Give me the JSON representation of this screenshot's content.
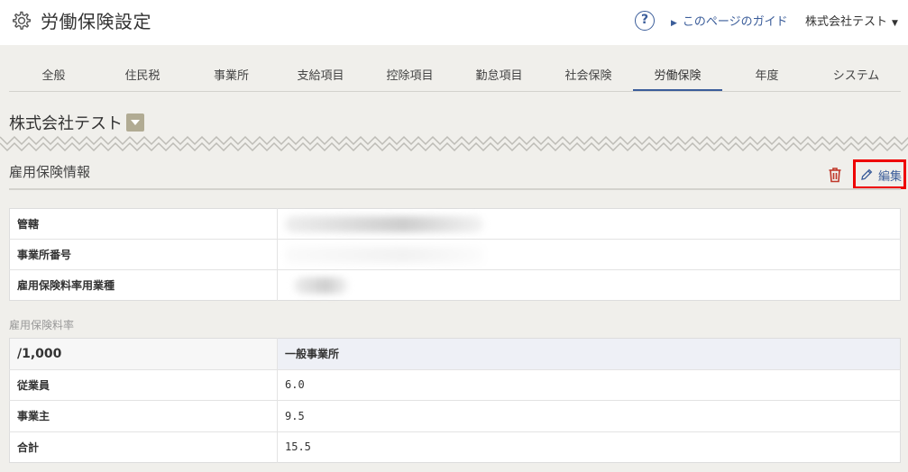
{
  "header": {
    "title": "労働保険設定",
    "help_label": "?",
    "guide_label": "このページのガイド",
    "company_menu_label": "株式会社テスト"
  },
  "tabs": [
    {
      "label": "全般"
    },
    {
      "label": "住民税"
    },
    {
      "label": "事業所"
    },
    {
      "label": "支給項目"
    },
    {
      "label": "控除項目"
    },
    {
      "label": "勤怠項目"
    },
    {
      "label": "社会保険"
    },
    {
      "label": "労働保険",
      "active": true
    },
    {
      "label": "年度"
    },
    {
      "label": "システム"
    }
  ],
  "company": {
    "name": "株式会社テスト"
  },
  "section": {
    "title": "雇用保険情報",
    "edit_label": "編集"
  },
  "info_rows": [
    {
      "label": "管轄",
      "value": ""
    },
    {
      "label": "事業所番号",
      "value": ""
    },
    {
      "label": "雇用保険料率用業種",
      "value": ""
    }
  ],
  "rates": {
    "caption": "雇用保険料率",
    "header": {
      "label": "/1,000",
      "value": "一般事業所"
    },
    "rows": [
      {
        "label": "従業員",
        "value": "6.0"
      },
      {
        "label": "事業主",
        "value": "9.5"
      },
      {
        "label": "合計",
        "value": "15.5"
      }
    ]
  },
  "colors": {
    "accent": "#3b5d9a",
    "highlight_border": "#ee0000",
    "trash": "#c0392b"
  }
}
